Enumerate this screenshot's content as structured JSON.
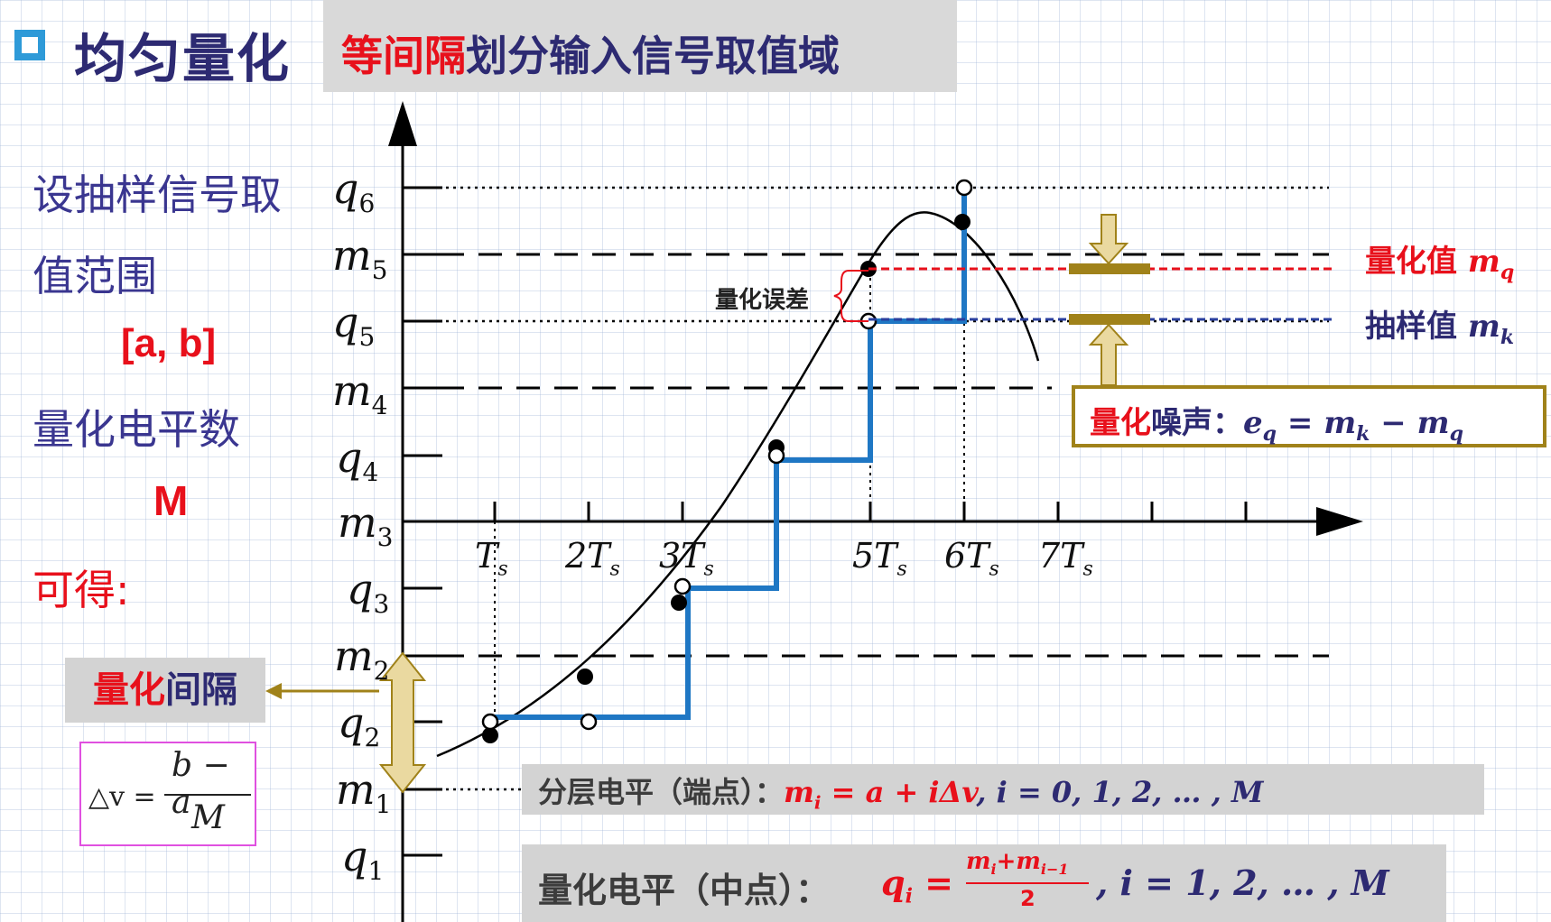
{
  "header": {
    "title": "均匀量化",
    "subtitle_red": "等间隔",
    "subtitle_rest": "划分输入信号取值域"
  },
  "left_panel": {
    "line1": "设抽样信号取",
    "line2": "值范围",
    "range": "[a, b]",
    "line3": "量化电平数",
    "M": "M",
    "result": "可得:",
    "interval_red": "量化",
    "interval_rest": "间隔",
    "formula_lhs": "△v =",
    "formula_num": "b − a",
    "formula_den": "M"
  },
  "diagram": {
    "y_labels": [
      {
        "base": "q",
        "sub": "6"
      },
      {
        "base": "m",
        "sub": "5"
      },
      {
        "base": "q",
        "sub": "5"
      },
      {
        "base": "m",
        "sub": "4"
      },
      {
        "base": "q",
        "sub": "4"
      },
      {
        "base": "m",
        "sub": "3"
      },
      {
        "base": "q",
        "sub": "3"
      },
      {
        "base": "m",
        "sub": "2"
      },
      {
        "base": "q",
        "sub": "2"
      },
      {
        "base": "m",
        "sub": "1"
      },
      {
        "base": "q",
        "sub": "1"
      }
    ],
    "x_labels": [
      {
        "base": "T",
        "sub": "s"
      },
      {
        "base": "2T",
        "sub": "s"
      },
      {
        "base": "3T",
        "sub": "s"
      },
      {
        "base": "5T",
        "sub": "s"
      },
      {
        "base": "6T",
        "sub": "s"
      },
      {
        "base": "7T",
        "sub": "s"
      }
    ],
    "error_label": "量化误差",
    "quantized_label": "量化值",
    "quantized_symbol": "m",
    "quantized_sub": "q",
    "sampled_label": "抽样值",
    "sampled_symbol": "m",
    "sampled_sub": "k"
  },
  "noise_box": {
    "red": "量化",
    "rest": "噪声：",
    "formula": "e",
    "sub_q": "q",
    "eq": " = m",
    "sub_k": "k",
    "minus": " − m",
    "sub_q2": "q"
  },
  "level_box": {
    "label": "分层电平（端点）：",
    "formula_red": "m",
    "sub": "i",
    "formula_red2": " = a + iΔv",
    "formula_rest": ", i = 0, 1, 2, … , M"
  },
  "quant_box": {
    "label": "量化电平（中点）：",
    "q": "q",
    "sub": "i",
    "eq": " = ",
    "num": "m",
    "num_sub1": "i",
    "num_plus": "+m",
    "num_sub2": "i−1",
    "den": "2",
    "rest": ", i = 1, 2, … , M"
  },
  "colors": {
    "accent_blue": "#1f77c4",
    "red": "#e8101b",
    "navy": "#2d2a72",
    "gold": "#a0821a",
    "arrow_fill": "#ead9a0"
  }
}
